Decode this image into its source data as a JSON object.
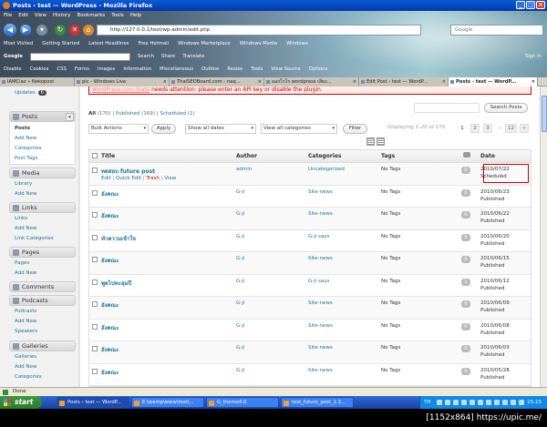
{
  "window": {
    "title": "Posts ‹ test — WordPress - Mozilla Firefox"
  },
  "menu": [
    "File",
    "Edit",
    "View",
    "History",
    "Bookmarks",
    "Tools",
    "Help"
  ],
  "nav": {
    "url": "http://127.0.0.1/test/wp-admin/edit.php",
    "search_engine": "Google"
  },
  "bookmarks": [
    "Most Visited",
    "Getting Started",
    "Latest Headlines",
    "Free Hotmail",
    "Windows Marketplace",
    "Windows Media",
    "Windows"
  ],
  "toolbar2": [
    "Google",
    "Search",
    "Share",
    "Translate",
    "Sign In"
  ],
  "toolbar3": [
    "Disable",
    "Cookies",
    "CSS",
    "Forms",
    "Images",
    "Information",
    "Miscellaneous",
    "Outline",
    "Resize",
    "Tools",
    "View Source",
    "Options"
  ],
  "tabs": [
    {
      "label": "IAMClaz » Nekopost"
    },
    {
      "label": "pic - Windows Live"
    },
    {
      "label": "ThaiSEOBoard.com - naq..."
    },
    {
      "label": "ออกไรไร wordpress เสียง..."
    },
    {
      "label": "Edit Post ‹ test — WordP..."
    },
    {
      "label": "Posts ‹ test — WordP..."
    }
  ],
  "sidebar": {
    "updates": {
      "label": "Updates",
      "count": "6"
    },
    "sections": [
      {
        "label": "Posts",
        "items": [
          "Posts",
          "Add New",
          "Categories",
          "Post Tags"
        ]
      },
      {
        "label": "Media",
        "items": [
          "Library",
          "Add New"
        ]
      },
      {
        "label": "Links",
        "items": [
          "Links",
          "Add New",
          "Link Categories"
        ]
      },
      {
        "label": "Pages",
        "items": [
          "Pages",
          "Add New"
        ]
      },
      {
        "label": "Comments",
        "items": []
      },
      {
        "label": "Podcasts",
        "items": [
          "Podcasts",
          "Add New",
          "Speakers"
        ]
      },
      {
        "label": "Galleries",
        "items": [
          "Galleries",
          "Add New",
          "Categories"
        ]
      }
    ]
  },
  "notice": {
    "link": "WordPress.com Stats",
    "text": " needs attention: please enter an API key or disable the plugin."
  },
  "filters": {
    "all": "All",
    "all_count": "(170)",
    "sep": "|",
    "published": "Published",
    "published_count": "(169)",
    "scheduled": "Scheduled",
    "scheduled_count": "(1)"
  },
  "search_button": "Search Posts",
  "bulk": {
    "action": "Bulk Actions",
    "apply": "Apply",
    "dates": "Show all dates",
    "categories": "View all categories",
    "filter": "Filter"
  },
  "paging": {
    "text": "Displaying 1–20 of 170",
    "pages": [
      "1",
      "2",
      "3",
      "...",
      "12",
      "»"
    ]
  },
  "columns": {
    "title": "Title",
    "author": "Author",
    "categories": "Categories",
    "tags": "Tags",
    "date": "Date"
  },
  "row_actions": {
    "edit": "Edit",
    "quick_edit": "Quick Edit",
    "trash": "Trash",
    "view": "View",
    "sep": "|"
  },
  "posts": [
    {
      "title": "ทดสอบ future post",
      "author": "admin",
      "categories": "Uncategorized",
      "tags": "No Tags",
      "comments": "0",
      "date": "2010/07/22",
      "status": "Scheduled"
    },
    {
      "title": "อังคณะ",
      "author": "G-ji",
      "categories": "Site-news",
      "tags": "No Tags",
      "comments": "0",
      "date": "2010/06/23",
      "status": "Published"
    },
    {
      "title": "อังคณะ",
      "author": "G-ji",
      "categories": "Site-news",
      "tags": "No Tags",
      "comments": "0",
      "date": "2010/06/22",
      "status": "Published"
    },
    {
      "title": "ทำความเข้าใจ",
      "author": "G-ji",
      "categories": "G-ji says",
      "tags": "No Tags",
      "comments": "0",
      "date": "2010/06/20",
      "status": "Published"
    },
    {
      "title": "อังคณะ",
      "author": "G-ji",
      "categories": "Site-news",
      "tags": "No Tags",
      "comments": "0",
      "date": "2010/06/15",
      "status": "Published"
    },
    {
      "title": "พูดไปทะลุมปี",
      "author": "G-ji",
      "categories": "G-ji says",
      "tags": "No Tags",
      "comments": "1",
      "date": "2010/06/12",
      "status": "Published"
    },
    {
      "title": "อังคณะ",
      "author": "G-ji",
      "categories": "Site-news",
      "tags": "No Tags",
      "comments": "0",
      "date": "2010/06/09",
      "status": "Published"
    },
    {
      "title": "อังคณะ",
      "author": "G-ji",
      "categories": "Site-news",
      "tags": "No Tags",
      "comments": "0",
      "date": "2010/06/08",
      "status": "Published"
    },
    {
      "title": "อังคณะ",
      "author": "G-ji",
      "categories": "Site-news",
      "tags": "No Tags",
      "comments": "0",
      "date": "2010/06/03",
      "status": "Published"
    },
    {
      "title": "อังคณะ",
      "author": "G-ji",
      "categories": "Site-news",
      "tags": "No Tags",
      "comments": "0",
      "date": "2010/05/28",
      "status": "Published"
    }
  ],
  "status": "Done",
  "taskbar": {
    "start": "start",
    "tasks": [
      "Posts ‹ test — WordP...",
      "E:\\wamp\\www\\test\\...",
      "G_theme4.0",
      "test_future_post_1.3..."
    ],
    "lang": "TH",
    "clock": "15:15"
  },
  "watermark": "[1152x864] https://upic.me/"
}
